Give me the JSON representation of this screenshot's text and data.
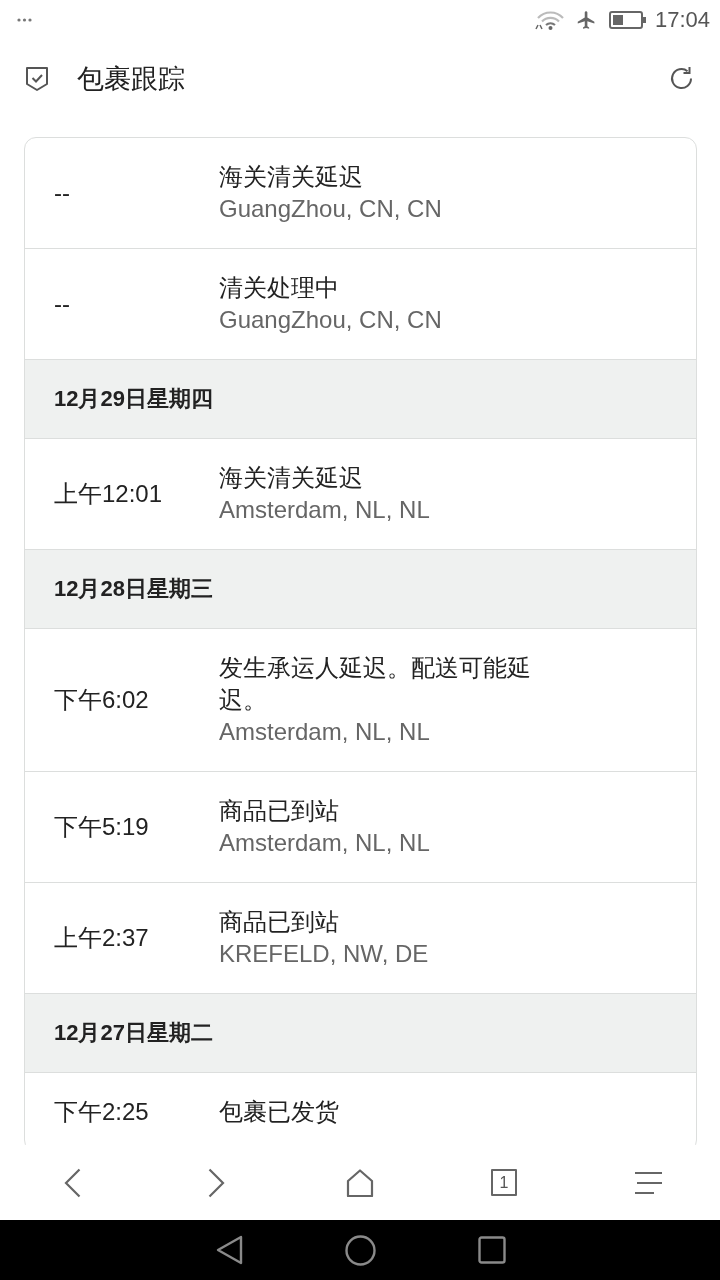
{
  "status_bar": {
    "time": "17:04"
  },
  "header": {
    "title": "包裹跟踪"
  },
  "timeline": [
    {
      "kind": "event",
      "time": "--",
      "status": "海关清关延迟",
      "location": "GuangZhou, CN, CN"
    },
    {
      "kind": "event",
      "time": "--",
      "status": "清关处理中",
      "location": "GuangZhou, CN, CN"
    },
    {
      "kind": "date",
      "label": "12月29日星期四"
    },
    {
      "kind": "event",
      "time": "上午12:01",
      "status": "海关清关延迟",
      "location": "Amsterdam, NL, NL"
    },
    {
      "kind": "date",
      "label": "12月28日星期三"
    },
    {
      "kind": "event",
      "time": "下午6:02",
      "status": "发生承运人延迟。配送可能延迟。",
      "location": "Amsterdam, NL, NL"
    },
    {
      "kind": "event",
      "time": "下午5:19",
      "status": "商品已到站",
      "location": "Amsterdam, NL, NL"
    },
    {
      "kind": "event",
      "time": "上午2:37",
      "status": "商品已到站",
      "location": "KREFELD, NW, DE"
    },
    {
      "kind": "date",
      "label": "12月27日星期二"
    },
    {
      "kind": "event",
      "time": "下午2:25",
      "status": "包裹已发货"
    }
  ],
  "toolbar": {
    "tab_count": "1"
  }
}
